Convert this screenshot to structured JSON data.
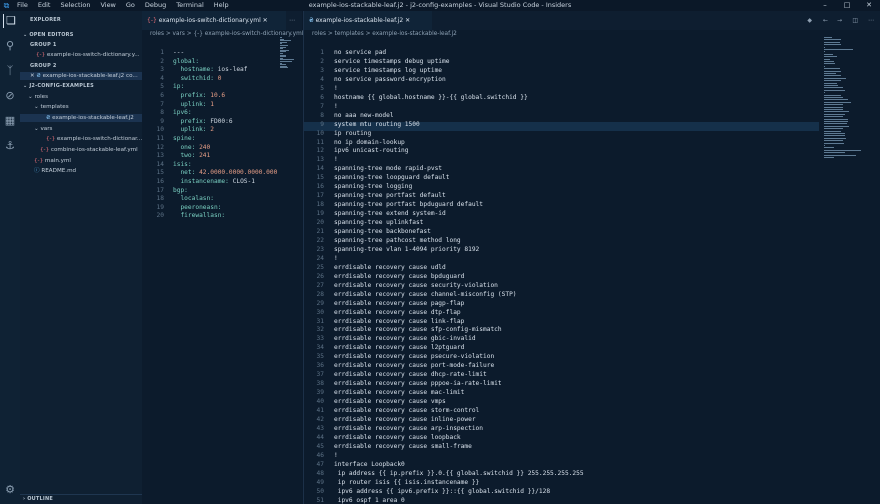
{
  "title_bar": {
    "menu": [
      "File",
      "Edit",
      "Selection",
      "View",
      "Go",
      "Debug",
      "Terminal",
      "Help"
    ],
    "window_title": "example-ios-stackable-leaf.j2 - j2-config-examples - Visual Studio Code - Insiders"
  },
  "sidebar": {
    "explorer_title": "EXPLORER",
    "open_editors": "OPEN EDITORS",
    "group1": "GROUP 1",
    "group1_file": "example-ios-switch-dictionary.y...",
    "group2": "GROUP 2",
    "group2_file": "example-ios-stackable-leaf.j2 co...",
    "project": "J2-CONFIG-EXAMPLES",
    "tree": {
      "roles": "roles",
      "templates": "templates",
      "leaf_file": "example-ios-stackable-leaf.j2",
      "vars": "vars",
      "dict_file": "example-ios-switch-dictionar...",
      "combine": "combine-ios-stackable-leaf.yml",
      "main": "main.yml",
      "readme": "README.md"
    },
    "outline": "OUTLINE"
  },
  "editor_left": {
    "tab": "example-ios-switch-dictionary.yml",
    "tab_icon": "{-}",
    "breadcrumb": "roles > vars > {-} example-ios-switch-dictionary.yml",
    "lines": [
      "---",
      "global:",
      "  hostname: ios-leaf",
      "  switchid: 0",
      "ip:",
      "  prefix: 10.6",
      "  uplink: 1",
      "ipv6:",
      "  prefix: FD00:6",
      "  uplink: 2",
      "spine:",
      "  one: 240",
      "  two: 241",
      "isis:",
      "  net: 42.0000.0000.0000.000",
      "  instancename: CLOS-1",
      "bgp:",
      "  localasn:",
      "  peeroneasn:",
      "  firewallasn:"
    ]
  },
  "editor_right": {
    "tab": "example-ios-stackable-leaf.j2",
    "breadcrumb": "roles > templates > example-ios-stackable-leaf.j2",
    "lines": [
      "no service pad",
      "service timestamps debug uptime",
      "service timestamps log uptime",
      "no service password-encryption",
      "!",
      "hostname {{ global.hostname }}-{{ global.switchid }}",
      "!",
      "no aaa new-model",
      "system mtu routing 1500",
      "ip routing",
      "no ip domain-lookup",
      "ipv6 unicast-routing",
      "!",
      "spanning-tree mode rapid-pvst",
      "spanning-tree loopguard default",
      "spanning-tree logging",
      "spanning-tree portfast default",
      "spanning-tree portfast bpduguard default",
      "spanning-tree extend system-id",
      "spanning-tree uplinkfast",
      "spanning-tree backbonefast",
      "spanning-tree pathcost method long",
      "spanning-tree vlan 1-4094 priority 8192",
      "!",
      "errdisable recovery cause udld",
      "errdisable recovery cause bpduguard",
      "errdisable recovery cause security-violation",
      "errdisable recovery cause channel-misconfig (STP)",
      "errdisable recovery cause pagp-flap",
      "errdisable recovery cause dtp-flap",
      "errdisable recovery cause link-flap",
      "errdisable recovery cause sfp-config-mismatch",
      "errdisable recovery cause gbic-invalid",
      "errdisable recovery cause l2ptguard",
      "errdisable recovery cause psecure-violation",
      "errdisable recovery cause port-mode-failure",
      "errdisable recovery cause dhcp-rate-limit",
      "errdisable recovery cause pppoe-ia-rate-limit",
      "errdisable recovery cause mac-limit",
      "errdisable recovery cause vmps",
      "errdisable recovery cause storm-control",
      "errdisable recovery cause inline-power",
      "errdisable recovery cause arp-inspection",
      "errdisable recovery cause loopback",
      "errdisable recovery cause small-frame",
      "!",
      "interface Loopback0",
      " ip address {{ ip.prefix }}.0.{{ global.switchid }} 255.255.255.255",
      " ip router isis {{ isis.instancename }}",
      " ipv6 address {{ ipv6.prefix }}::{{ global.switchid }}/128",
      " ipv6 ospf 1 area 0"
    ]
  },
  "colors": {
    "background": "#0b1a2b",
    "accent": "#3b9ae8",
    "yaml_key": "#7ad0c2",
    "yaml_number": "#e89f87"
  }
}
